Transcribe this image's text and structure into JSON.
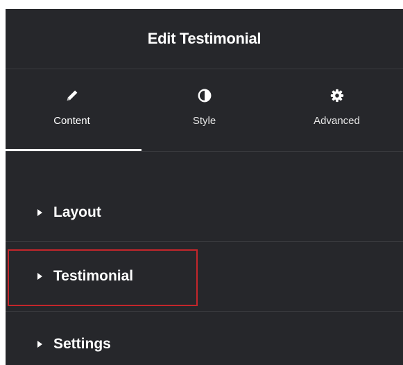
{
  "panel": {
    "title": "Edit Testimonial"
  },
  "tabs": [
    {
      "label": "Content",
      "icon": "pencil-icon",
      "active": true
    },
    {
      "label": "Style",
      "icon": "contrast-icon",
      "active": false
    },
    {
      "label": "Advanced",
      "icon": "gear-icon",
      "active": false
    }
  ],
  "sections": [
    {
      "label": "Layout",
      "icon": "caret-right-icon"
    },
    {
      "label": "Testimonial",
      "icon": "caret-right-icon",
      "highlighted": true
    },
    {
      "label": "Settings",
      "icon": "caret-right-icon"
    }
  ],
  "colors": {
    "panel_bg": "#26272b",
    "divider": "#3a3b3f",
    "text": "#ffffff",
    "highlight_border": "#c4262b"
  }
}
